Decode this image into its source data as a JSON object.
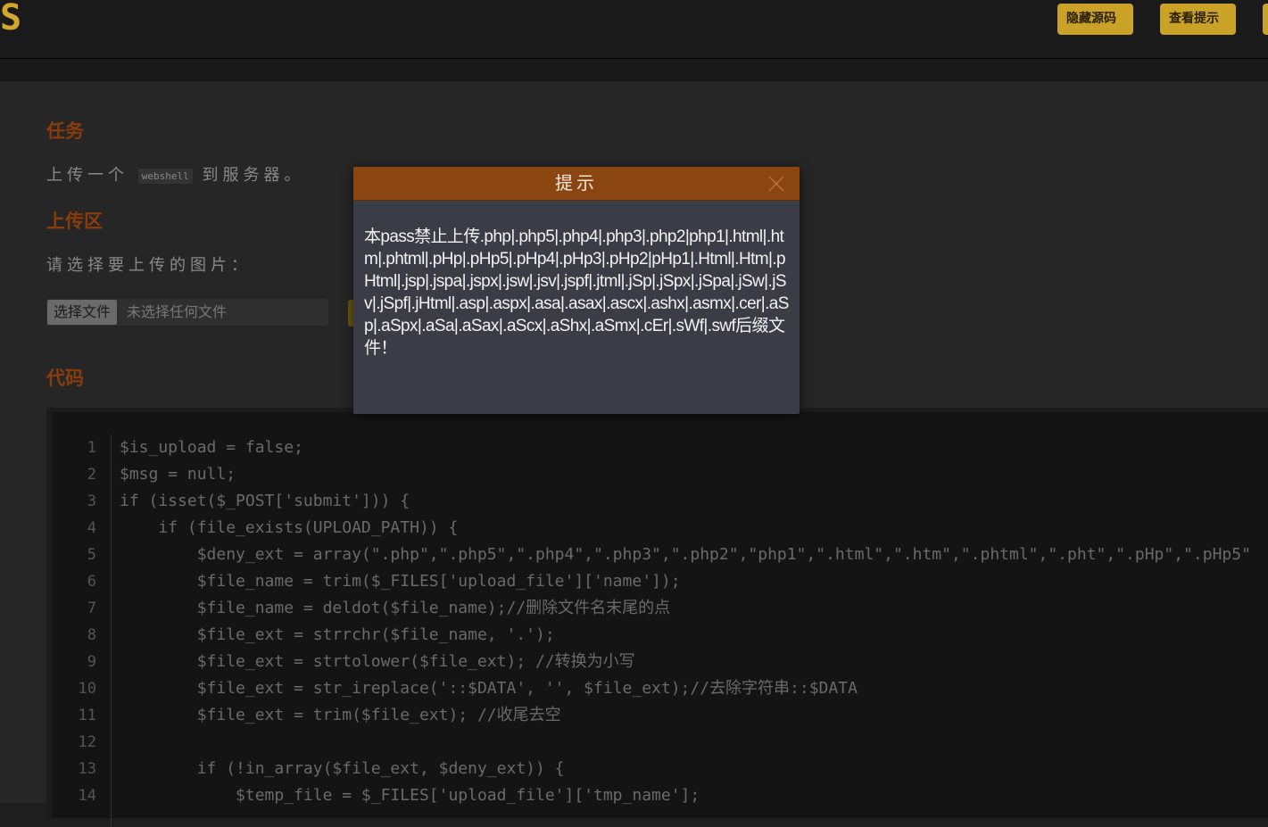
{
  "header": {
    "logo_char": "S",
    "hide_source_label": "隐藏源码",
    "view_hint_label": "查看提示"
  },
  "task": {
    "heading": "任务",
    "desc_before": "上传一个",
    "desc_code": "webshell",
    "desc_after": "到服务器。"
  },
  "upload": {
    "heading": "上传区",
    "choose_label": "请选择要上传的图片：",
    "file_button_label": "选择文件",
    "file_status": "未选择任何文件"
  },
  "code": {
    "heading": "代码",
    "lines": [
      {
        "num": "1",
        "text": "$is_upload = false;"
      },
      {
        "num": "2",
        "text": "$msg = null;"
      },
      {
        "num": "3",
        "text": "if (isset($_POST['submit'])) {"
      },
      {
        "num": "4",
        "text": "    if (file_exists(UPLOAD_PATH)) {"
      },
      {
        "num": "5",
        "text": "        $deny_ext = array(\".php\",\".php5\",\".php4\",\".php3\",\".php2\",\"php1\",\".html\",\".htm\",\".phtml\",\".pht\",\".pHp\",\".pHp5\""
      },
      {
        "num": "6",
        "text": "        $file_name = trim($_FILES['upload_file']['name']);"
      },
      {
        "num": "7",
        "text": "        $file_name = deldot($file_name);//删除文件名末尾的点"
      },
      {
        "num": "8",
        "text": "        $file_ext = strrchr($file_name, '.');"
      },
      {
        "num": "9",
        "text": "        $file_ext = strtolower($file_ext); //转换为小写"
      },
      {
        "num": "10",
        "text": "        $file_ext = str_ireplace('::$DATA', '', $file_ext);//去除字符串::$DATA"
      },
      {
        "num": "11",
        "text": "        $file_ext = trim($file_ext); //收尾去空"
      },
      {
        "num": "12",
        "text": ""
      },
      {
        "num": "13",
        "text": "        if (!in_array($file_ext, $deny_ext)) {"
      },
      {
        "num": "14",
        "text": "            $temp_file = $_FILES['upload_file']['tmp_name'];"
      }
    ]
  },
  "dialog": {
    "title": "提示",
    "message": "本pass禁止上传.php|.php5|.php4|.php3|.php2|php1|.html|.htm|.phtml|.pHp|.pHp5|.pHp4|.pHp3|.pHp2|pHp1|.Html|.Htm|.pHtml|.jsp|.jspa|.jspx|.jsw|.jsv|.jspf|.jtml|.jSp|.jSpx|.jSpa|.jSw|.jSv|.jSpf|.jHtml|.asp|.aspx|.asa|.asax|.ascx|.ashx|.asmx|.cer|.aSp|.aSpx|.aSa|.aSax|.aScx|.aShx|.aSmx|.cEr|.sWf|.swf后缀文件！"
  },
  "colors": {
    "accent_gold": "#c9a227",
    "heading_orange": "#8a3c0b",
    "dialog_title_bg": "#8b4511",
    "dialog_bg": "#3a3d46"
  }
}
